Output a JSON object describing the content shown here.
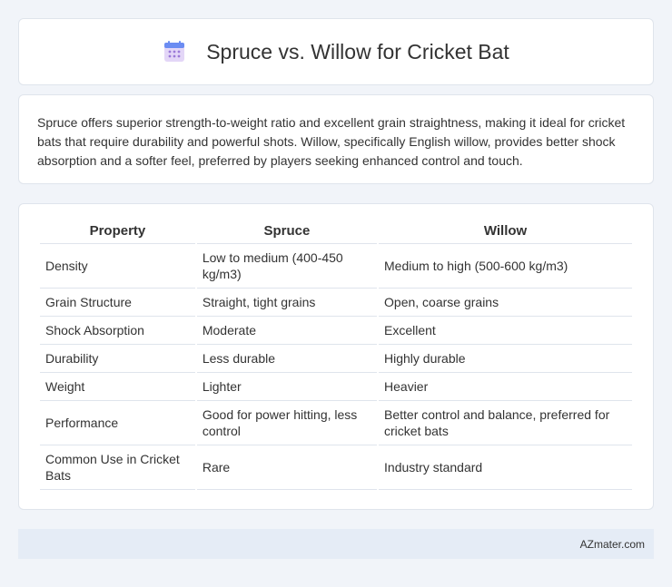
{
  "header": {
    "title": "Spruce vs. Willow for Cricket Bat",
    "icon": "calendar-icon",
    "icon_colors": {
      "top": "#6b8cf2",
      "body": "#e3d6f7",
      "dots": "#9b7ad8"
    }
  },
  "summary": {
    "text": "Spruce offers superior strength-to-weight ratio and excellent grain straightness, making it ideal for cricket bats that require durability and powerful shots. Willow, specifically English willow, provides better shock absorption and a softer feel, preferred by players seeking enhanced control and touch."
  },
  "table": {
    "headers": [
      "Property",
      "Spruce",
      "Willow"
    ],
    "rows": [
      [
        "Density",
        "Low to medium (400-450 kg/m3)",
        "Medium to high (500-600 kg/m3)"
      ],
      [
        "Grain Structure",
        "Straight, tight grains",
        "Open, coarse grains"
      ],
      [
        "Shock Absorption",
        "Moderate",
        "Excellent"
      ],
      [
        "Durability",
        "Less durable",
        "Highly durable"
      ],
      [
        "Weight",
        "Lighter",
        "Heavier"
      ],
      [
        "Performance",
        "Good for power hitting, less control",
        "Better control and balance, preferred for cricket bats"
      ],
      [
        "Common Use in Cricket Bats",
        "Rare",
        "Industry standard"
      ]
    ]
  },
  "footer": {
    "text": "AZmater.com"
  }
}
